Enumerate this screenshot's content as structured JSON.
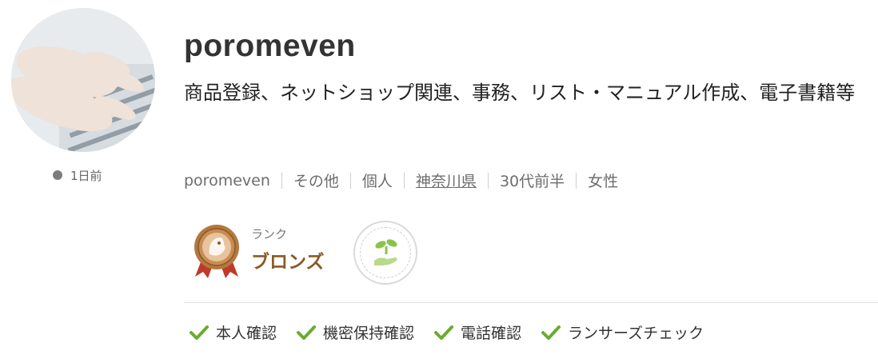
{
  "profile": {
    "username": "poromeven",
    "tagline": "商品登録、ネットショップ関連、事務、リスト・マニュアル作成、電子書籍等",
    "last_active": "1日前"
  },
  "meta": [
    {
      "label": "poromeven",
      "link": false
    },
    {
      "label": "その他",
      "link": false
    },
    {
      "label": "個人",
      "link": false
    },
    {
      "label": "神奈川県",
      "link": true
    },
    {
      "label": "30代前半",
      "link": false
    },
    {
      "label": "女性",
      "link": false
    }
  ],
  "rank": {
    "label": "ランク",
    "name": "ブロンズ"
  },
  "badge": {
    "icon": "sprout-hand-icon"
  },
  "verifications": [
    {
      "label": "本人確認"
    },
    {
      "label": "機密保持確認"
    },
    {
      "label": "電話確認"
    },
    {
      "label": "ランサーズチェック"
    }
  ],
  "colors": {
    "check": "#6aac2e",
    "bronze": "#8a5a25",
    "ribbon": "#c0392b",
    "sprout": "#8bc34a"
  }
}
